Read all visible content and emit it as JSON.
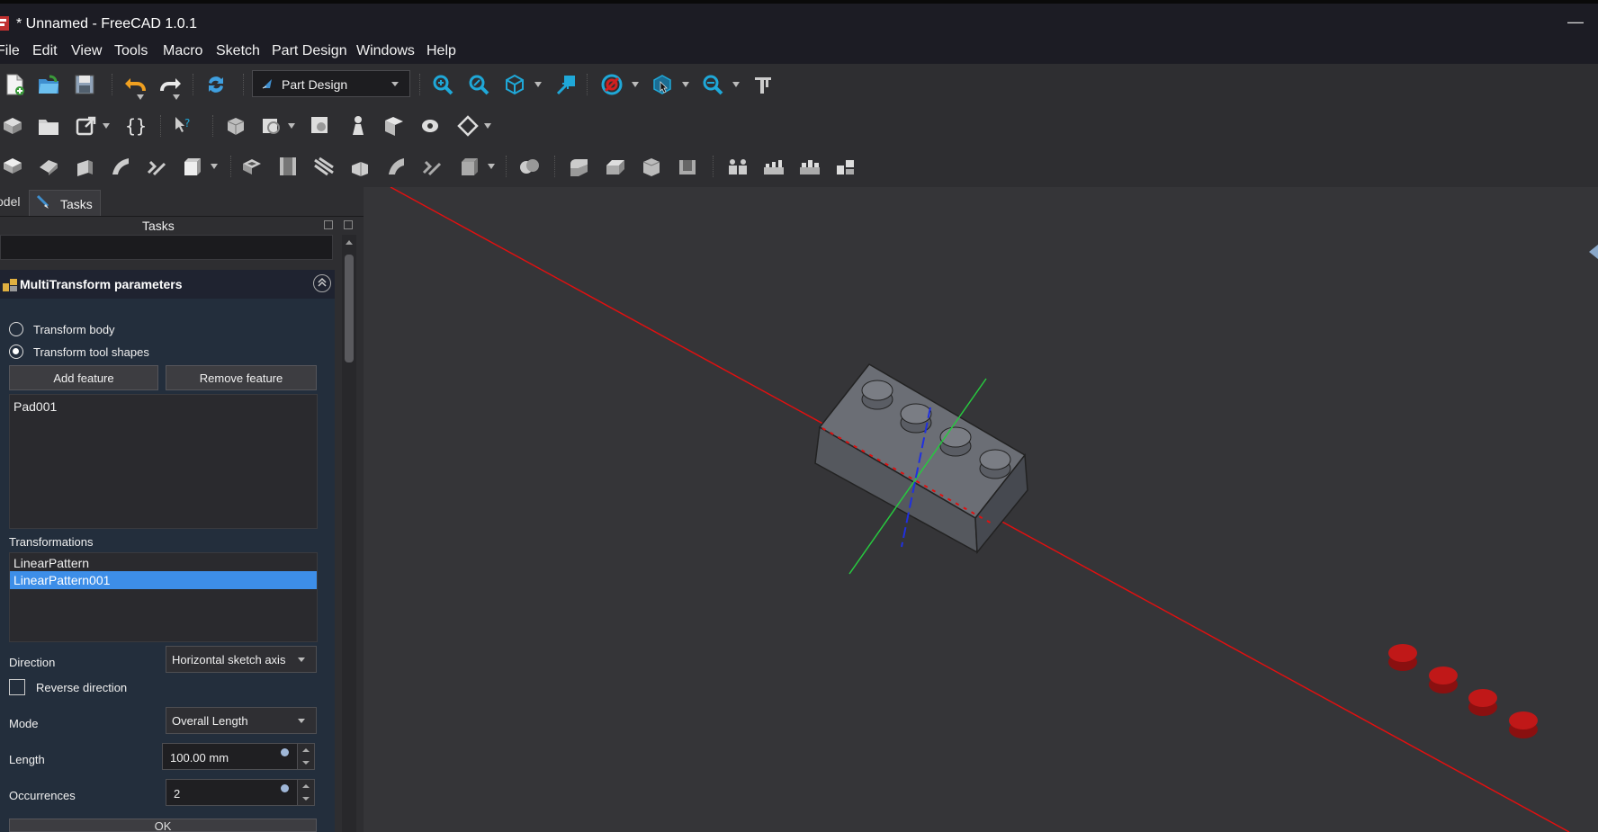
{
  "window": {
    "title": "* Unnamed - FreeCAD 1.0.1",
    "minimize_glyph": "—"
  },
  "menu": [
    "File",
    "Edit",
    "View",
    "Tools",
    "Macro",
    "Sketch",
    "Part Design",
    "Windows",
    "Help"
  ],
  "workbench": {
    "selected": "Part Design"
  },
  "panel": {
    "tab_model": "odel",
    "tab_tasks": "Tasks",
    "tasks_header": "Tasks"
  },
  "multitransform": {
    "title": "MultiTransform parameters",
    "radio_transform_body": "Transform body",
    "radio_transform_tool": "Transform tool shapes",
    "add_feature": "Add feature",
    "remove_feature": "Remove feature",
    "features": [
      "Pad001"
    ],
    "transformations_label": "Transformations",
    "transformations": [
      "LinearPattern",
      "LinearPattern001"
    ],
    "selected_transformation": "LinearPattern001",
    "direction_label": "Direction",
    "direction_value": "Horizontal sketch axis",
    "reverse_label": "Reverse direction",
    "mode_label": "Mode",
    "mode_value": "Overall Length",
    "length_label": "Length",
    "length_value": "100.00 mm",
    "occurrences_label": "Occurrences",
    "occurrences_value": "2",
    "ok_label": "OK"
  },
  "colors": {
    "accent_selection": "#3d8ee8",
    "x_axis": "#e01010",
    "y_axis": "#27c93f",
    "z_axis": "#2030e0",
    "panel_body": "#232e3c"
  }
}
